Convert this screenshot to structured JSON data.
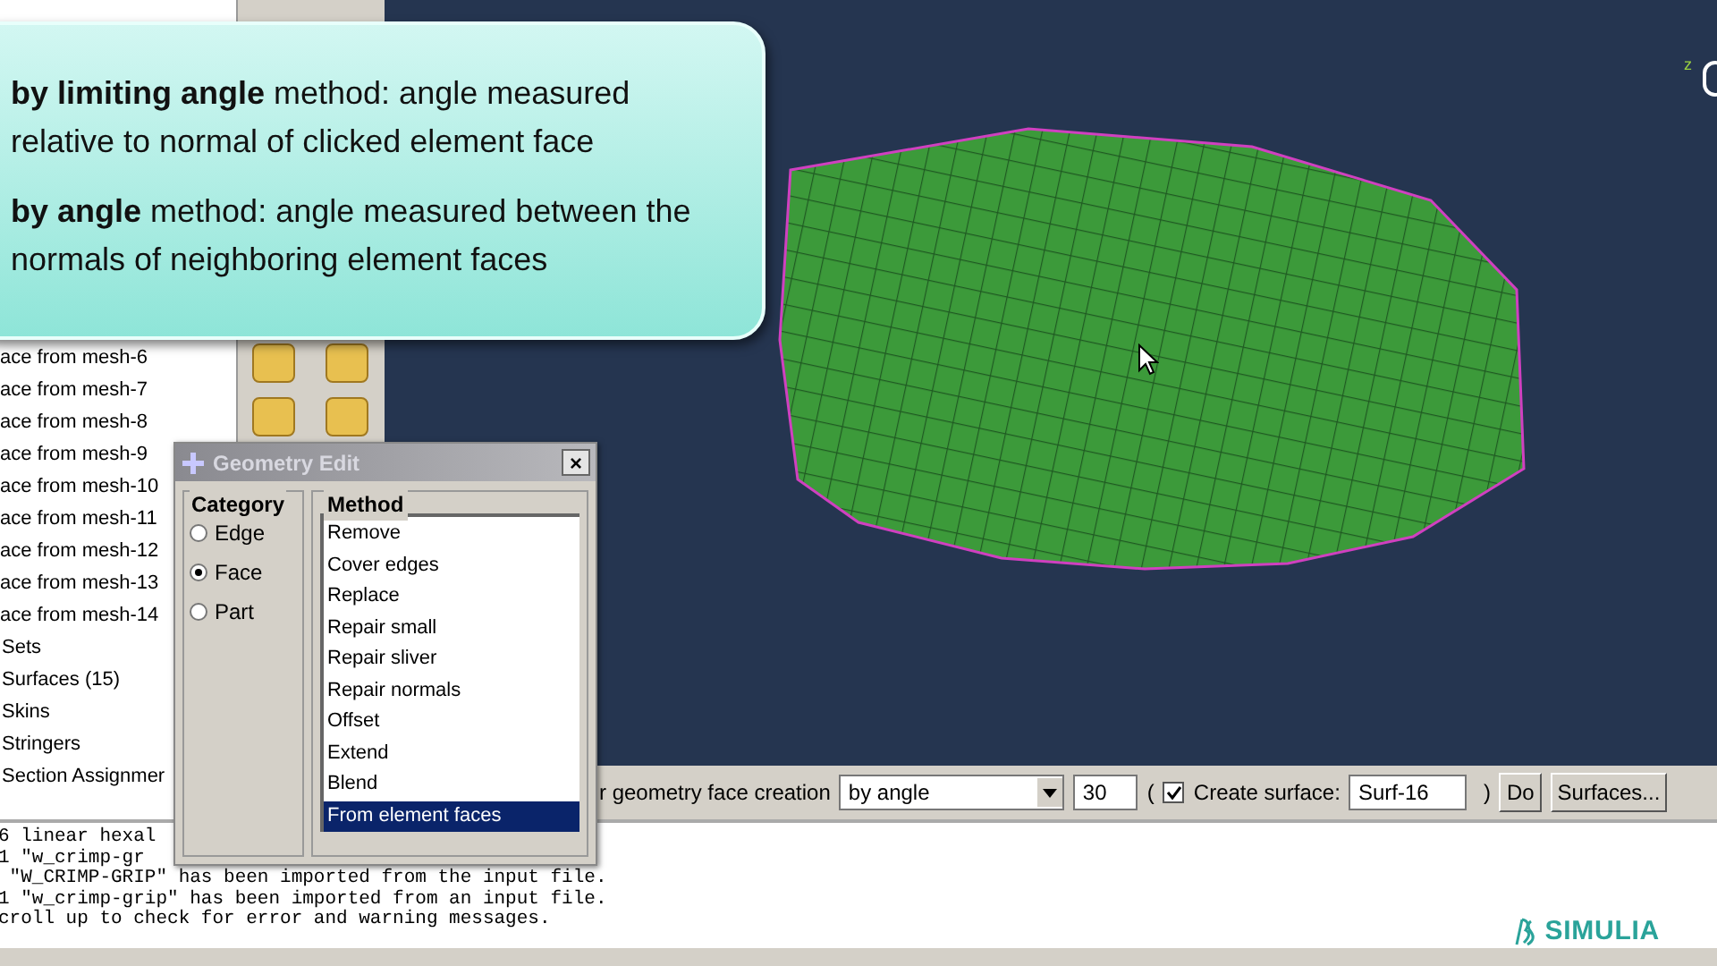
{
  "callout": {
    "paragraphs": [
      "**by limiting angle** method: angle measured relative to normal of clicked element face",
      "**by angle** method: angle measured between the normals of neighboring element faces"
    ]
  },
  "model_tree": {
    "items": [
      {
        "label": "ace from mesh-6"
      },
      {
        "label": "ace from mesh-7"
      },
      {
        "label": "ace from mesh-8"
      },
      {
        "label": "ace from mesh-9"
      },
      {
        "label": "ace from mesh-10"
      },
      {
        "label": "ace from mesh-11"
      },
      {
        "label": "ace from mesh-12"
      },
      {
        "label": "ace from mesh-13"
      },
      {
        "label": "ace from mesh-14"
      },
      {
        "label": "Sets"
      },
      {
        "label": "Surfaces (15)"
      },
      {
        "label": "Skins"
      },
      {
        "label": "Stringers"
      },
      {
        "label": "Section Assignmer"
      }
    ]
  },
  "viewport": {
    "axis_label": "z"
  },
  "dialog": {
    "title": "Geometry Edit",
    "close": "×",
    "category": {
      "label": "Category",
      "options": [
        {
          "label": "Edge",
          "selected": false
        },
        {
          "label": "Face",
          "selected": true
        },
        {
          "label": "Part",
          "selected": false
        }
      ]
    },
    "method": {
      "label": "Method",
      "items": [
        {
          "label": "Remove",
          "selected": false
        },
        {
          "label": "Cover edges",
          "selected": false
        },
        {
          "label": "Replace",
          "selected": false
        },
        {
          "label": "Repair small",
          "selected": false
        },
        {
          "label": "Repair sliver",
          "selected": false
        },
        {
          "label": "Repair normals",
          "selected": false
        },
        {
          "label": "Offset",
          "selected": false
        },
        {
          "label": "Extend",
          "selected": false
        },
        {
          "label": "Blend",
          "selected": false
        },
        {
          "label": "From element faces",
          "selected": true
        }
      ]
    }
  },
  "prompt": {
    "text": "r geometry face creation",
    "method_select": "by angle",
    "angle": "30",
    "open_paren": "(",
    "create_surface": {
      "checked": true,
      "label": "Create surface:"
    },
    "surface_name": "Surf-16",
    "close_paren": ")",
    "buttons": [
      "Do",
      "Surfaces..."
    ]
  },
  "messages": [
    "6 linear hexal",
    "1 \"w_crimp-gr",
    " \"W_CRIMP-GRIP\" has been imported from the input file.",
    "1 \"w_crimp-grip\" has been imported from an input file.",
    "croll up to check for error and warning messages."
  ],
  "logo": "SIMULIA"
}
